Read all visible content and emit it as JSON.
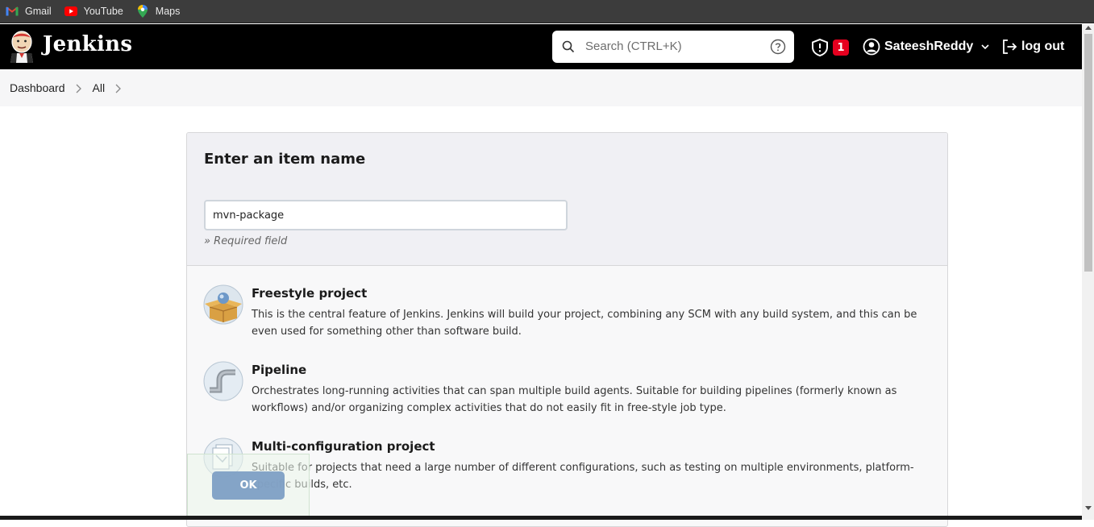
{
  "bookmarks": [
    {
      "label": "Gmail",
      "icon": "gmail-icon"
    },
    {
      "label": "YouTube",
      "icon": "youtube-icon"
    },
    {
      "label": "Maps",
      "icon": "maps-icon"
    }
  ],
  "header": {
    "brand": "Jenkins",
    "search_placeholder": "Search (CTRL+K)",
    "security_count": "1",
    "username": "SateeshReddy",
    "logout_label": "log out"
  },
  "breadcrumb": [
    "Dashboard",
    "All"
  ],
  "form": {
    "title": "Enter an item name",
    "item_name_value": "mvn-package",
    "required_note": "» Required field"
  },
  "item_types": [
    {
      "name": "Freestyle project",
      "description": "This is the central feature of Jenkins. Jenkins will build your project, combining any SCM with any build system, and this can be even used for something other than software build."
    },
    {
      "name": "Pipeline",
      "description": "Orchestrates long-running activities that can span multiple build agents. Suitable for building pipelines (formerly known as workflows) and/or organizing complex activities that do not easily fit in free-style job type."
    },
    {
      "name": "Multi-configuration project",
      "description": "Suitable for projects that need a large number of different configurations, such as testing on multiple environments, platform-specific builds, etc."
    }
  ],
  "ok_label": "OK",
  "colors": {
    "header_bg": "#000000",
    "badge": "#e6001f",
    "ok_button": "#7fa0c5"
  }
}
